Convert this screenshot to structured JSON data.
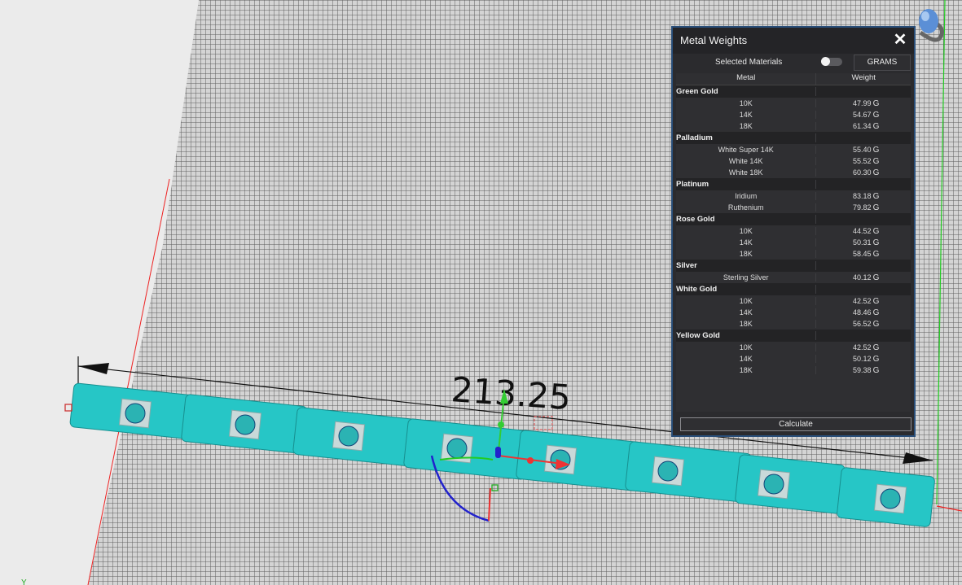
{
  "viewport": {
    "dimension_value": "213.25"
  },
  "panel": {
    "title": "Metal Weights",
    "close_label": "✕",
    "selected_materials_label": "Selected Materials",
    "selected_materials_on": false,
    "unit_button_label": "GRAMS",
    "columns": {
      "metal": "Metal",
      "weight": "Weight"
    },
    "unit_suffix": "G",
    "groups": [
      {
        "name": "Green Gold",
        "items": [
          {
            "metal": "10K",
            "weight": "47.99"
          },
          {
            "metal": "14K",
            "weight": "54.67"
          },
          {
            "metal": "18K",
            "weight": "61.34"
          }
        ]
      },
      {
        "name": "Palladium",
        "items": [
          {
            "metal": "White Super 14K",
            "weight": "55.40"
          },
          {
            "metal": "White 14K",
            "weight": "55.52"
          },
          {
            "metal": "White 18K",
            "weight": "60.30"
          }
        ]
      },
      {
        "name": "Platinum",
        "items": [
          {
            "metal": "Iridium",
            "weight": "83.18"
          },
          {
            "metal": "Ruthenium",
            "weight": "79.82"
          }
        ]
      },
      {
        "name": "Rose Gold",
        "items": [
          {
            "metal": "10K",
            "weight": "44.52"
          },
          {
            "metal": "14K",
            "weight": "50.31"
          },
          {
            "metal": "18K",
            "weight": "58.45"
          }
        ]
      },
      {
        "name": "Silver",
        "items": [
          {
            "metal": "Sterling Silver",
            "weight": "40.12"
          }
        ]
      },
      {
        "name": "White Gold",
        "items": [
          {
            "metal": "10K",
            "weight": "42.52"
          },
          {
            "metal": "14K",
            "weight": "48.46"
          },
          {
            "metal": "18K",
            "weight": "56.52"
          }
        ]
      },
      {
        "name": "Yellow Gold",
        "items": [
          {
            "metal": "10K",
            "weight": "42.52"
          },
          {
            "metal": "14K",
            "weight": "50.12"
          },
          {
            "metal": "18K",
            "weight": "59.38"
          }
        ]
      }
    ],
    "calculate_label": "Calculate"
  },
  "colors": {
    "model": "#26c6c6",
    "grid_line": "#6e6e6e",
    "panel_bg": "#2b2b2e",
    "panel_border": "#2a4f7a"
  },
  "icons": [
    "close-icon",
    "view-cube-icon"
  ]
}
